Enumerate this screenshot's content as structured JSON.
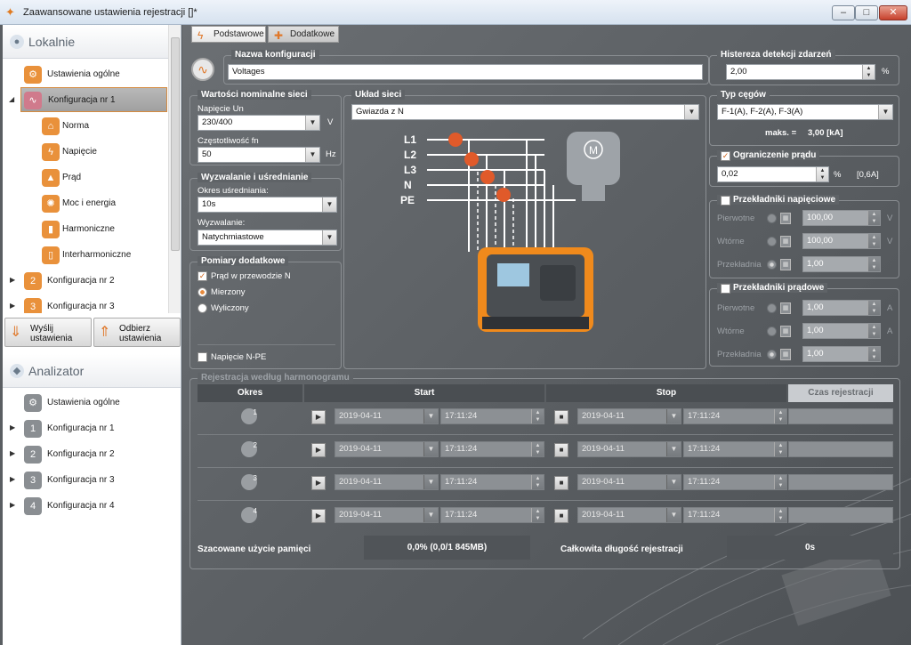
{
  "window": {
    "title": "Zaawansowane ustawienia rejestracji []*",
    "min": "‒",
    "max": "□",
    "close": "✕"
  },
  "left": {
    "local_header": "Lokalnie",
    "local_items": [
      {
        "label": "Ustawienia ogólne",
        "icon": "settings-icon"
      },
      {
        "label": "Konfiguracja nr 1",
        "icon": "config-1-icon"
      },
      {
        "label": "Norma",
        "icon": "norm-icon"
      },
      {
        "label": "Napięcie",
        "icon": "voltage-icon"
      },
      {
        "label": "Prąd",
        "icon": "current-icon"
      },
      {
        "label": "Moc i energia",
        "icon": "power-icon"
      },
      {
        "label": "Harmoniczne",
        "icon": "harmonics-icon"
      },
      {
        "label": "Interharmoniczne",
        "icon": "interharmonics-icon"
      },
      {
        "label": "Konfiguracja nr 2",
        "icon": "config-2-icon"
      },
      {
        "label": "Konfiguracja nr 3",
        "icon": "config-3-icon"
      }
    ],
    "send_button": "Wyślij\nustawienia",
    "receive_button": "Odbierz\nustawienia",
    "analyzer_header": "Analizator",
    "analyzer_items": [
      {
        "label": "Ustawienia ogólne"
      },
      {
        "label": "Konfiguracja nr 1"
      },
      {
        "label": "Konfiguracja nr 2"
      },
      {
        "label": "Konfiguracja nr 3"
      },
      {
        "label": "Konfiguracja nr 4"
      }
    ]
  },
  "tabs": {
    "basic": "Podstawowe",
    "additional": "Dodatkowe"
  },
  "config_name": {
    "title": "Nazwa konfiguracji",
    "value": "Voltages"
  },
  "hysteresis": {
    "title": "Histereza detekcji zdarzeń",
    "value": "2,00",
    "unit": "%"
  },
  "nominal": {
    "title": "Wartości nominalne sieci",
    "voltage_label": "Napięcie Un",
    "voltage_value": "230/400",
    "voltage_unit": "V",
    "freq_label": "Częstotliwość fn",
    "freq_value": "50",
    "freq_unit": "Hz"
  },
  "trigger": {
    "title": "Wyzwalanie i uśrednianie",
    "avg_label": "Okres uśredniania:",
    "avg_value": "10s",
    "trig_label": "Wyzwalanie:",
    "trig_value": "Natychmiastowe"
  },
  "extra": {
    "title": "Pomiary dodatkowe",
    "neutral_current": "Prąd w przewodzie N",
    "measured": "Mierzony",
    "calculated": "Wyliczony",
    "npe_voltage": "Napięcie N-PE"
  },
  "network": {
    "title": "Układ sieci",
    "value": "Gwiazda z N",
    "lines": [
      "L1",
      "L2",
      "L3",
      "N",
      "PE"
    ],
    "motor_label": "M"
  },
  "clamps": {
    "title": "Typ cęgów",
    "value": "F-1(A), F-2(A), F-3(A)",
    "max_label": "maks. =",
    "max_value": "3,00 [kA]"
  },
  "current_limit": {
    "title": "Ograniczenie prądu",
    "value": "0,02",
    "unit": "%",
    "abs": "[0,6A]"
  },
  "vt": {
    "title": "Przekładniki napięciowe",
    "rows": [
      {
        "label": "Pierwotne",
        "value": "100,00",
        "unit": "V"
      },
      {
        "label": "Wtórne",
        "value": "100,00",
        "unit": "V"
      },
      {
        "label": "Przekładnia",
        "value": "1,00",
        "unit": ""
      }
    ]
  },
  "ct": {
    "title": "Przekładniki prądowe",
    "rows": [
      {
        "label": "Pierwotne",
        "value": "1,00",
        "unit": "A"
      },
      {
        "label": "Wtórne",
        "value": "1,00",
        "unit": "A"
      },
      {
        "label": "Przekładnia",
        "value": "1,00",
        "unit": ""
      }
    ]
  },
  "schedule": {
    "title": "Rejestracja według harmonogramu",
    "col_period": "Okres",
    "col_start": "Start",
    "col_stop": "Stop",
    "col_duration": "Czas rejestracji",
    "rows": [
      {
        "n": "1",
        "start_date": "2019-04-11",
        "start_time": "17:11:24",
        "stop_date": "2019-04-11",
        "stop_time": "17:11:24"
      },
      {
        "n": "2",
        "start_date": "2019-04-11",
        "start_time": "17:11:24",
        "stop_date": "2019-04-11",
        "stop_time": "17:11:24"
      },
      {
        "n": "3",
        "start_date": "2019-04-11",
        "start_time": "17:11:24",
        "stop_date": "2019-04-11",
        "stop_time": "17:11:24"
      },
      {
        "n": "4",
        "start_date": "2019-04-11",
        "start_time": "17:11:24",
        "stop_date": "2019-04-11",
        "stop_time": "17:11:24"
      }
    ]
  },
  "memory": {
    "label": "Szacowane użycie pamięci",
    "value": "0,0% (0,0/1 845MB)"
  },
  "total": {
    "label": "Całkowita długość rejestracji",
    "value": "0s"
  }
}
